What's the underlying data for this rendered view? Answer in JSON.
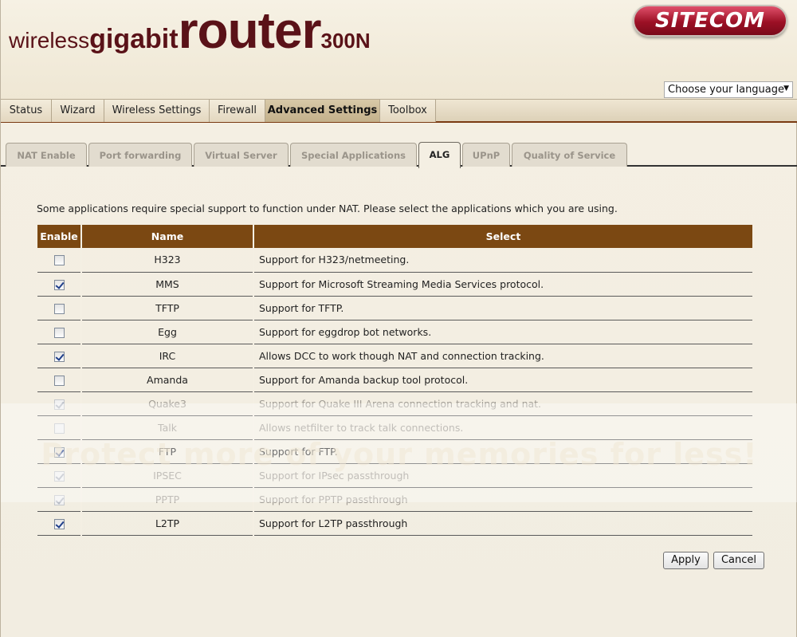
{
  "header": {
    "title_part1": "wireless ",
    "title_part2": "gigabit",
    "title_part3": "router",
    "title_part4": "300N",
    "brand": "SITECOM"
  },
  "language_select": {
    "value": "Choose your language"
  },
  "main_nav": {
    "items": [
      {
        "label": "Status"
      },
      {
        "label": "Wizard"
      },
      {
        "label": "Wireless Settings"
      },
      {
        "label": "Firewall"
      },
      {
        "label": "Advanced Settings",
        "active": true
      },
      {
        "label": "Toolbox"
      }
    ]
  },
  "sub_tabs": {
    "items": [
      {
        "label": "NAT Enable"
      },
      {
        "label": "Port forwarding"
      },
      {
        "label": "Virtual Server"
      },
      {
        "label": "Special Applications"
      },
      {
        "label": "ALG",
        "active": true
      },
      {
        "label": "UPnP"
      },
      {
        "label": "Quality of Service"
      }
    ]
  },
  "intro_text": "Some applications require special support to function under NAT. Please select the applications which you are using.",
  "table": {
    "headers": {
      "enable": "Enable",
      "name": "Name",
      "select": "Select"
    },
    "rows": [
      {
        "checked": false,
        "disabled": false,
        "name": "H323",
        "description": "Support for H323/netmeeting."
      },
      {
        "checked": true,
        "disabled": false,
        "name": "MMS",
        "description": "Support for Microsoft Streaming Media Services protocol."
      },
      {
        "checked": false,
        "disabled": false,
        "name": "TFTP",
        "description": "Support for TFTP."
      },
      {
        "checked": false,
        "disabled": false,
        "name": "Egg",
        "description": "Support for eggdrop bot networks."
      },
      {
        "checked": true,
        "disabled": false,
        "name": "IRC",
        "description": "Allows DCC to work though NAT and connection tracking."
      },
      {
        "checked": false,
        "disabled": false,
        "name": "Amanda",
        "description": "Support for Amanda backup tool protocol."
      },
      {
        "checked": true,
        "disabled": true,
        "name": "Quake3",
        "description": "Support for Quake III Arena connection tracking and nat."
      },
      {
        "checked": false,
        "disabled": true,
        "name": "Talk",
        "description": "Allows netfilter to track talk connections."
      },
      {
        "checked": true,
        "disabled": false,
        "name": "FTP",
        "description": "Support for FTP."
      },
      {
        "checked": true,
        "disabled": true,
        "name": "IPSEC",
        "description": "Support for IPsec passthrough"
      },
      {
        "checked": true,
        "disabled": true,
        "name": "PPTP",
        "description": "Support for PPTP passthrough"
      },
      {
        "checked": true,
        "disabled": false,
        "name": "L2TP",
        "description": "Support for L2TP passthrough"
      }
    ]
  },
  "buttons": {
    "apply": "Apply",
    "cancel": "Cancel"
  },
  "watermark": {
    "text": "Protect more of your memories for less!"
  },
  "colors": {
    "header_bar": "#7b4812",
    "title": "#5a1218",
    "brand": "#9c1025",
    "checkmark": "#1f3e8a"
  }
}
